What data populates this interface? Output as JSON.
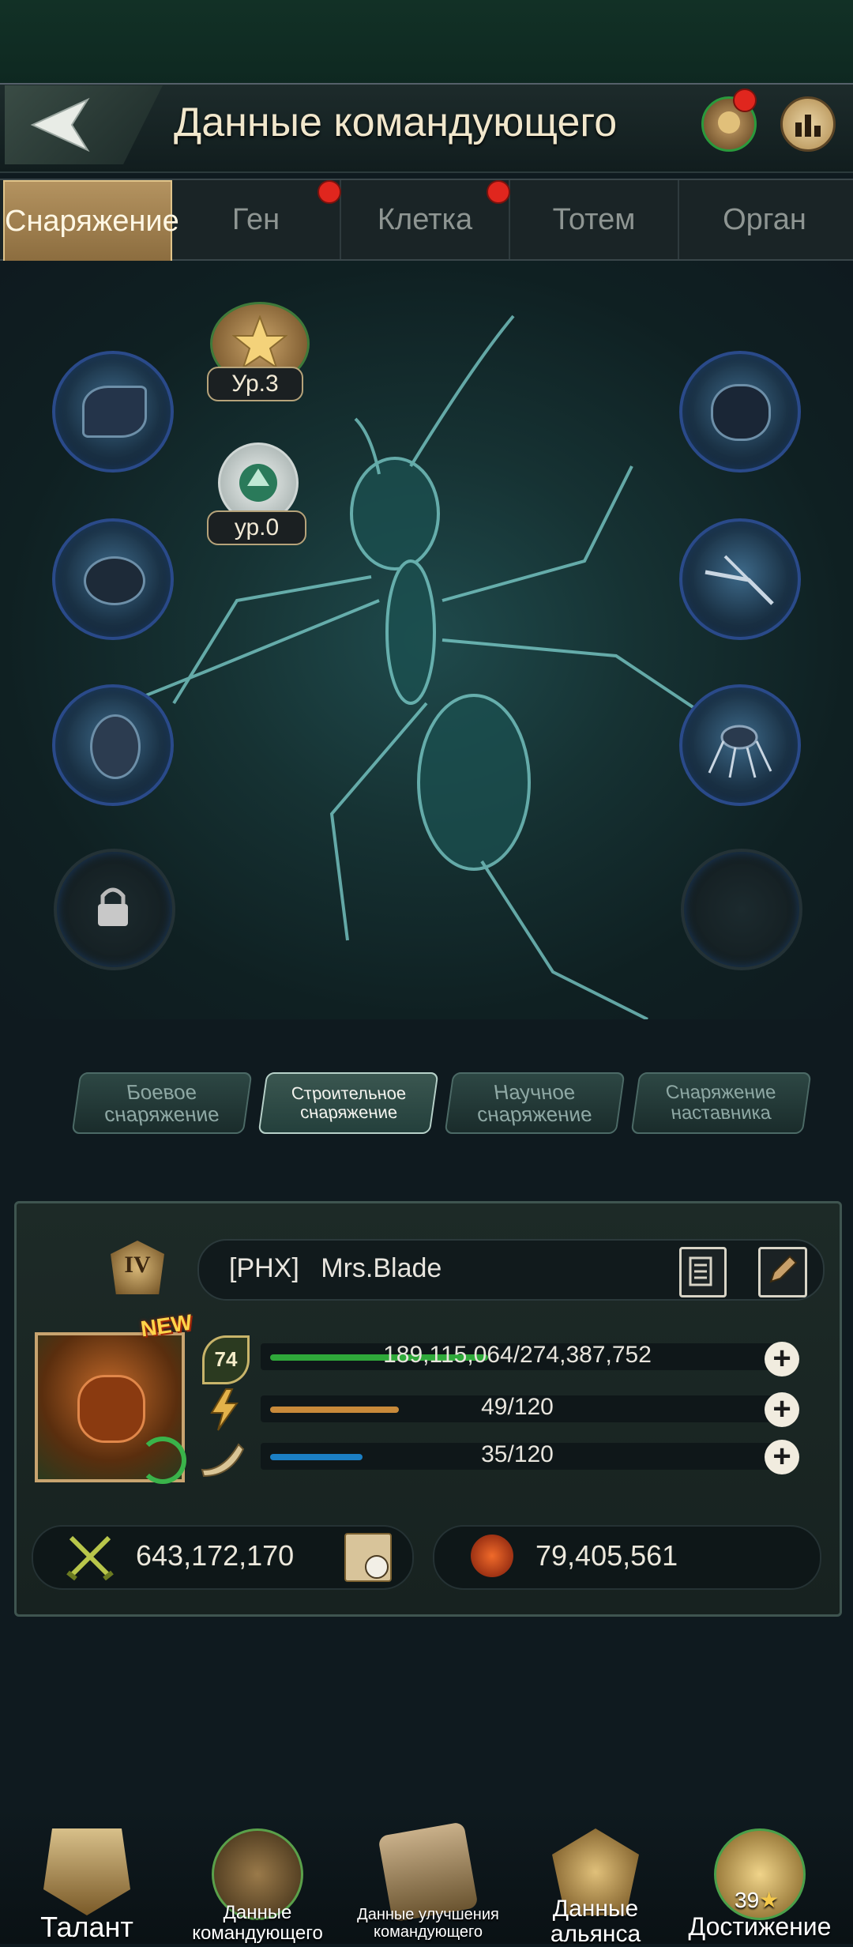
{
  "header": {
    "title": "Данные командующего",
    "back_icon": "back-arrow-icon",
    "profile_icon": "commander-profile-icon",
    "stats_icon": "bar-chart-icon"
  },
  "tabs": [
    {
      "label": "Снаряжение",
      "active": true,
      "badge": false
    },
    {
      "label": "Ген",
      "active": false,
      "badge": true
    },
    {
      "label": "Клетка",
      "active": false,
      "badge": true
    },
    {
      "label": "Тотем",
      "active": false,
      "badge": false
    },
    {
      "label": "Орган",
      "active": false,
      "badge": false
    }
  ],
  "badges": {
    "star_level": "Ур.3",
    "emblem_level": "ур.0"
  },
  "gear_slots": {
    "left": [
      "mandible-gear-icon",
      "thorax-gear-icon",
      "abdomen-gear-icon",
      "locked-slot-icon"
    ],
    "right": [
      "head-gear-icon",
      "antenna-gear-icon",
      "legs-gear-icon",
      "empty-slot"
    ]
  },
  "categories": [
    {
      "label_line1": "Боевое",
      "label_line2": "снаряжение",
      "active": false
    },
    {
      "label_line1": "Строительное",
      "label_line2": "снаряжение",
      "active": true
    },
    {
      "label_line1": "Научное",
      "label_line2": "снаряжение",
      "active": false
    },
    {
      "label_line1": "Снаряжение",
      "label_line2": "наставника",
      "active": false
    }
  ],
  "commander": {
    "rank": "IV",
    "tag": "[PHX]",
    "name": "Mrs.Blade",
    "new_badge": "NEW",
    "level": "74",
    "exp": "189,115,064/274,387,752",
    "exp_fraction": 0.689,
    "energy": "49/120",
    "energy_fraction": 0.408,
    "horn": "35/120",
    "horn_fraction": 0.292,
    "power": "643,172,170",
    "kills": "79,405,561"
  },
  "colors": {
    "exp": "#2fa83a",
    "energy": "#c88a3a",
    "horn": "#1b7fc4",
    "tab_active": "#b49360",
    "red_dot": "#e0261e"
  },
  "nav": [
    {
      "line1": "Талант",
      "line2": ""
    },
    {
      "line1": "Данные",
      "line2": "командующего"
    },
    {
      "line1": "Данные улучшения",
      "line2": "командующего"
    },
    {
      "line1": "Данные",
      "line2": "альянса"
    },
    {
      "line1": "Достижение",
      "line2": "",
      "count": "39"
    }
  ]
}
